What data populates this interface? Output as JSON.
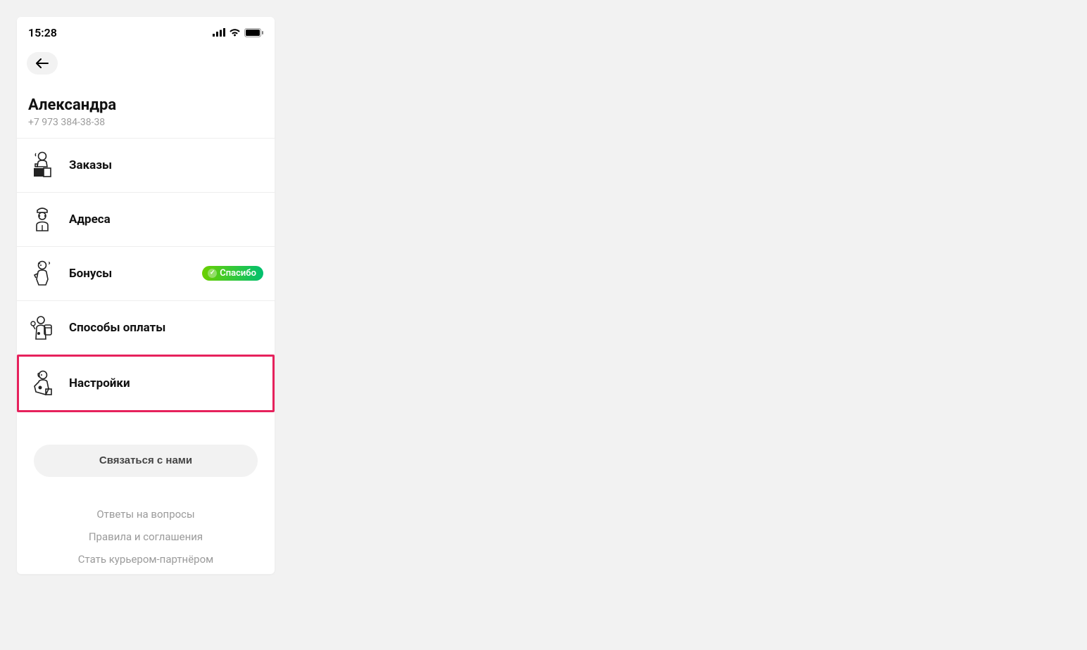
{
  "status": {
    "time": "15:28"
  },
  "header": {},
  "profile": {
    "name": "Александра",
    "phone": "+7 973 384-38-38"
  },
  "menu": {
    "items": [
      {
        "label": "Заказы",
        "icon": "orders-icon",
        "badge": null
      },
      {
        "label": "Адреса",
        "icon": "addresses-icon",
        "badge": null
      },
      {
        "label": "Бонусы",
        "icon": "bonuses-icon",
        "badge": "Спасибо"
      },
      {
        "label": "Способы оплаты",
        "icon": "payment-methods-icon",
        "badge": null
      },
      {
        "label": "Настройки",
        "icon": "settings-icon",
        "badge": null,
        "highlighted": true
      }
    ]
  },
  "actions": {
    "contact_label": "Связаться с нами"
  },
  "links": [
    "Ответы на вопросы",
    "Правила и соглашения",
    "Стать курьером-партнёром"
  ]
}
